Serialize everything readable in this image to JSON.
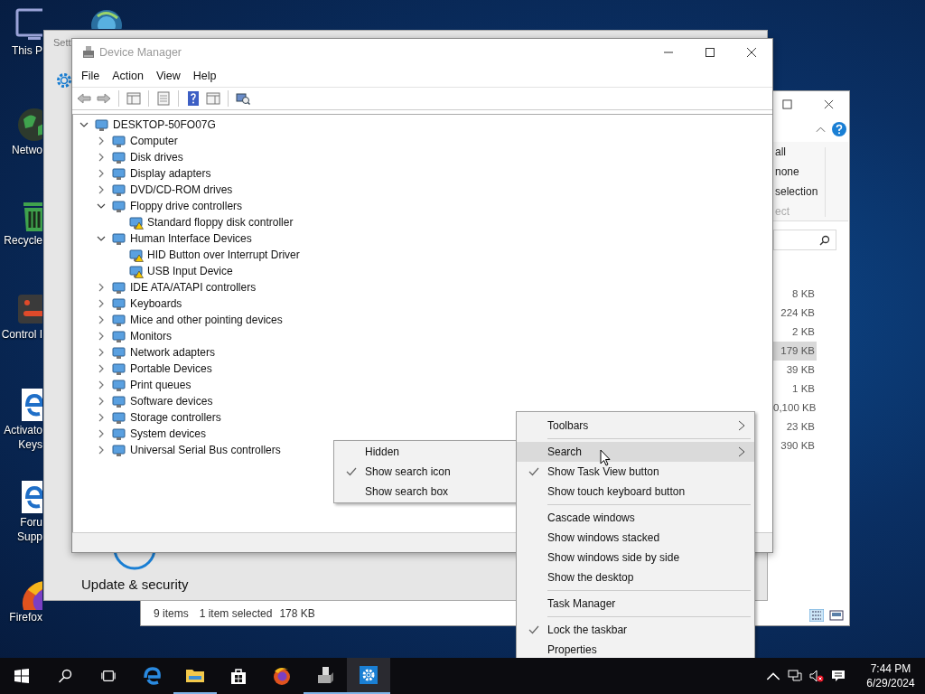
{
  "desktop_icons": [
    {
      "kind": "monitor",
      "lines": [
        "This P"
      ]
    },
    {
      "kind": "globe",
      "lines": [
        "Netwo"
      ]
    },
    {
      "kind": "bin",
      "lines": [
        "Recycle"
      ]
    },
    {
      "kind": "panel",
      "lines": [
        "Control I"
      ]
    },
    {
      "kind": "edge",
      "lines": [
        "Activato",
        "Keys"
      ]
    },
    {
      "kind": "edge",
      "lines": [
        "Foru",
        "Supp"
      ]
    },
    {
      "kind": "firefox",
      "lines": [
        "Firefox"
      ]
    }
  ],
  "settings_window": {
    "title": "Sett",
    "section": "Update & security"
  },
  "explorer_window": {
    "ribbon_items": [
      "all",
      "none",
      "selection"
    ],
    "ribbon_group": "ect",
    "sizes": [
      {
        "text": "8 KB",
        "selected": false
      },
      {
        "text": "224 KB",
        "selected": false
      },
      {
        "text": "2 KB",
        "selected": false
      },
      {
        "text": "179 KB",
        "selected": true
      },
      {
        "text": "39 KB",
        "selected": false
      },
      {
        "text": "1 KB",
        "selected": false
      },
      {
        "text": "0,100 KB",
        "selected": false
      },
      {
        "text": "23 KB",
        "selected": false
      },
      {
        "text": "390 KB",
        "selected": false
      }
    ],
    "status_bar": {
      "item_count": "9 items",
      "selection": "1 item selected",
      "selection_size": "178 KB"
    }
  },
  "device_manager": {
    "title": "Device Manager",
    "menu": [
      "File",
      "Action",
      "View",
      "Help"
    ],
    "tree": {
      "label": "DESKTOP-50FO07G",
      "expanded": true,
      "warning": false,
      "children": [
        {
          "label": "Computer",
          "expanded": false,
          "warning": false
        },
        {
          "label": "Disk drives",
          "expanded": false,
          "warning": false
        },
        {
          "label": "Display adapters",
          "expanded": false,
          "warning": false
        },
        {
          "label": "DVD/CD-ROM drives",
          "expanded": false,
          "warning": false
        },
        {
          "label": "Floppy drive controllers",
          "expanded": true,
          "warning": false,
          "children": [
            {
              "label": "Standard floppy disk controller",
              "warning": true
            }
          ]
        },
        {
          "label": "Human Interface Devices",
          "expanded": true,
          "warning": false,
          "children": [
            {
              "label": "HID Button over Interrupt Driver",
              "warning": true
            },
            {
              "label": "USB Input Device",
              "warning": true
            }
          ]
        },
        {
          "label": "IDE ATA/ATAPI controllers",
          "expanded": false,
          "warning": false
        },
        {
          "label": "Keyboards",
          "expanded": false,
          "warning": false
        },
        {
          "label": "Mice and other pointing devices",
          "expanded": false,
          "warning": false
        },
        {
          "label": "Monitors",
          "expanded": false,
          "warning": false
        },
        {
          "label": "Network adapters",
          "expanded": false,
          "warning": false
        },
        {
          "label": "Portable Devices",
          "expanded": false,
          "warning": false
        },
        {
          "label": "Print queues",
          "expanded": false,
          "warning": false
        },
        {
          "label": "Software devices",
          "expanded": false,
          "warning": false
        },
        {
          "label": "Storage controllers",
          "expanded": false,
          "warning": false
        },
        {
          "label": "System devices",
          "expanded": false,
          "warning": false
        },
        {
          "label": "Universal Serial Bus controllers",
          "expanded": false,
          "warning": false
        }
      ]
    }
  },
  "search_submenu": {
    "items": [
      {
        "label": "Hidden",
        "checked": false
      },
      {
        "label": "Show search icon",
        "checked": true
      },
      {
        "label": "Show search box",
        "checked": false
      }
    ]
  },
  "taskbar_menu": {
    "items": [
      {
        "kind": "item",
        "label": "Toolbars",
        "checked": false,
        "submenu": true,
        "selected": false
      },
      {
        "kind": "separator"
      },
      {
        "kind": "item",
        "label": "Search",
        "checked": false,
        "submenu": true,
        "selected": true
      },
      {
        "kind": "item",
        "label": "Show Task View button",
        "checked": true,
        "submenu": false,
        "selected": false
      },
      {
        "kind": "item",
        "label": "Show touch keyboard button",
        "checked": false,
        "submenu": false,
        "selected": false
      },
      {
        "kind": "separator"
      },
      {
        "kind": "item",
        "label": "Cascade windows",
        "checked": false,
        "submenu": false,
        "selected": false
      },
      {
        "kind": "item",
        "label": "Show windows stacked",
        "checked": false,
        "submenu": false,
        "selected": false
      },
      {
        "kind": "item",
        "label": "Show windows side by side",
        "checked": false,
        "submenu": false,
        "selected": false
      },
      {
        "kind": "item",
        "label": "Show the desktop",
        "checked": false,
        "submenu": false,
        "selected": false
      },
      {
        "kind": "separator"
      },
      {
        "kind": "item",
        "label": "Task Manager",
        "checked": false,
        "submenu": false,
        "selected": false
      },
      {
        "kind": "separator"
      },
      {
        "kind": "item",
        "label": "Lock the taskbar",
        "checked": true,
        "submenu": false,
        "selected": false
      },
      {
        "kind": "item",
        "label": "Properties",
        "checked": false,
        "submenu": false,
        "selected": false
      }
    ]
  },
  "taskbar": {
    "apps": [
      {
        "kind": "edge",
        "running": false,
        "active": false
      },
      {
        "kind": "folder",
        "running": true,
        "active": false
      },
      {
        "kind": "store",
        "running": false,
        "active": false
      },
      {
        "kind": "firefox",
        "running": false,
        "active": false
      },
      {
        "kind": "device",
        "running": true,
        "active": false
      },
      {
        "kind": "gear",
        "running": true,
        "active": true
      }
    ],
    "time": "7:44 PM",
    "date": "6/29/2024"
  }
}
